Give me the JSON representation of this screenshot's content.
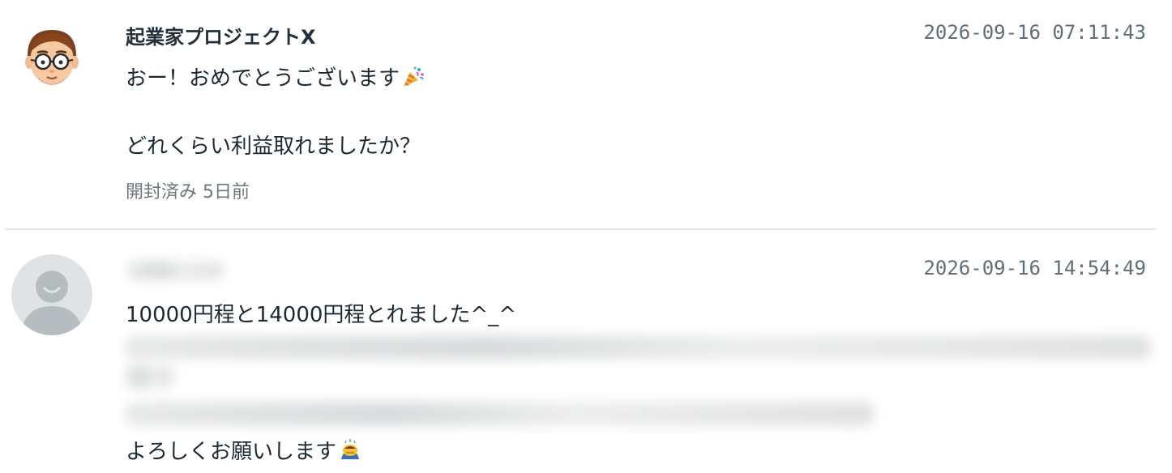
{
  "messages": [
    {
      "sender": "起業家プロジェクトX",
      "timestamp": "2026-09-16 07:11:43",
      "lines": [
        "おー！おめでとうございます",
        "どれくらい利益取れましたか？"
      ],
      "emoji_icon": "party-popper-icon",
      "read_status": "開封済み 5日前"
    },
    {
      "sender": "",
      "timestamp": "2026-09-16 14:54:49",
      "lines": [
        "10000円程と14000円程とれました^_^",
        "よろしくお願いします"
      ],
      "emoji_icon": "bowing-person-icon"
    }
  ],
  "colors": {
    "text": "#1b2934",
    "muted": "#616e78",
    "divider": "#e3e6e8",
    "default_avatar_bg": "#e0e3e5",
    "default_avatar_fg": "#b6bdc1"
  }
}
